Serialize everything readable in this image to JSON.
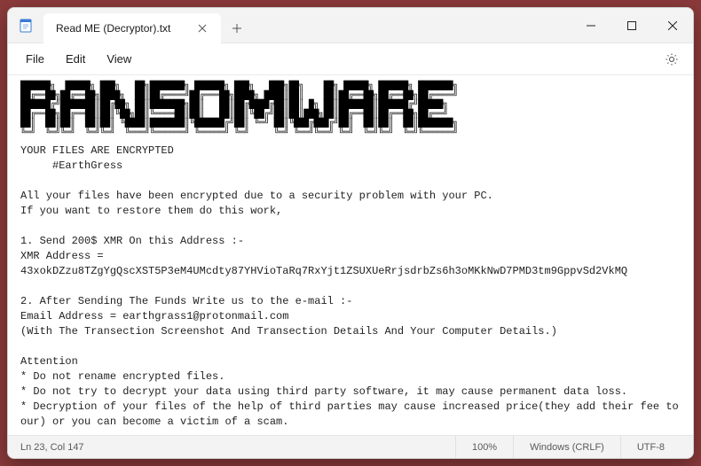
{
  "window": {
    "tab_title": "Read ME (Decryptor).txt"
  },
  "menu": {
    "file": "File",
    "edit": "Edit",
    "view": "View"
  },
  "ascii": "██████╗  █████╗ ███╗   ██╗███████╗ ██████╗ ███╗   ███╗██╗    ██╗ █████╗ ██████╗ ███████╗\n██╔══██╗██╔══██╗████╗  ██║██╔════╝██╔═══██╗████╗ ████║██║    ██║██╔══██╗██╔══██╗██╔════╝\n██████╔╝███████║██╔██╗ ██║███████╗██║   ██║██╔████╔██║██║ █╗ ██║███████║██████╔╝█████╗  \n██╔══██╗██╔══██║██║╚██╗██║╚════██║██║   ██║██║╚██╔╝██║██║███╗██║██╔══██║██╔══██╗██╔══╝  \n██║  ██║██║  ██║██║ ╚████║███████║╚██████╔╝██║ ╚═╝ ██║╚███╔███╔╝██║  ██║██║  ██║███████╗\n╚═╝  ╚═╝╚═╝  ╚═╝╚═╝  ╚═══╝╚══════╝ ╚═════╝ ╚═╝     ╚═╝ ╚══╝╚══╝ ╚═╝  ╚═╝╚═╝  ╚═╝╚══════╝",
  "note": "YOUR FILES ARE ENCRYPTED\n     #EarthGress\n\nAll your files have been encrypted due to a security problem with your PC.\nIf you want to restore them do this work,\n\n1. Send 200$ XMR On this Address :-\nXMR Address = 43xokDZzu8TZgYgQscXST5P3eM4UMcdty87YHVioTaRq7RxYjt1ZSUXUeRrjsdrbZs6h3oMKkNwD7PMD3tm9GppvSd2VkMQ\n\n2. After Sending The Funds Write us to the e-mail :-\nEmail Address = earthgrass1@protonmail.com\n(With The Transection Screenshot And Transection Details And Your Computer Details.)\n\nAttention\n* Do not rename encrypted files.\n* Do not try to decrypt your data using third party software, it may cause permanent data loss.\n* Decryption of your files of the help of third parties may cause increased price(they add their fee to our) or you can become a victim of a scam.",
  "status": {
    "position": "Ln 23, Col 147",
    "zoom": "100%",
    "eol": "Windows (CRLF)",
    "encoding": "UTF-8"
  }
}
